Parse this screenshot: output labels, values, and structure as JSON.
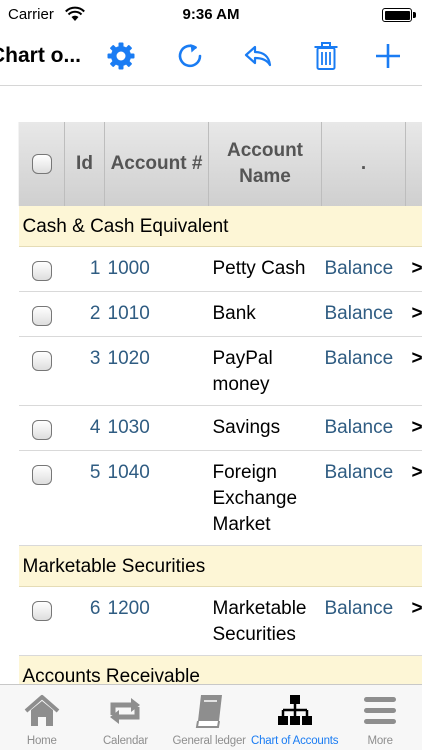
{
  "status_bar": {
    "carrier": "Carrier",
    "time": "9:36 AM"
  },
  "nav": {
    "title": "Chart o...",
    "actions": [
      "gear-icon",
      "refresh-icon",
      "reply-icon",
      "trash-icon",
      "plus-icon"
    ]
  },
  "table": {
    "headers": {
      "id": "Id",
      "account_num": "Account #",
      "account_name": "Account Name",
      "col5": ".",
      "col6": "."
    },
    "groups": [
      {
        "label": "Cash & Cash Equivalent",
        "rows": [
          {
            "id": "1",
            "num": "1000",
            "name": "Petty Cash",
            "action": "Balance",
            "more": ">"
          },
          {
            "id": "2",
            "num": "1010",
            "name": "Bank",
            "action": "Balance",
            "more": ">"
          },
          {
            "id": "3",
            "num": "1020",
            "name": "PayPal money",
            "action": "Balance",
            "more": ">"
          },
          {
            "id": "4",
            "num": "1030",
            "name": "Savings",
            "action": "Balance",
            "more": ">"
          },
          {
            "id": "5",
            "num": "1040",
            "name": "Foreign Exchange Market",
            "action": "Balance",
            "more": ">"
          }
        ]
      },
      {
        "label": "Marketable Securities",
        "rows": [
          {
            "id": "6",
            "num": "1200",
            "name": "Marketable Securities",
            "action": "Balance",
            "more": ">"
          }
        ]
      },
      {
        "label": "Accounts Receivable",
        "rows": []
      }
    ]
  },
  "tabs": [
    {
      "label": "Home",
      "icon": "home-icon"
    },
    {
      "label": "Calendar",
      "icon": "repeat-icon"
    },
    {
      "label": "General ledger",
      "icon": "book-icon"
    },
    {
      "label": "Chart of Accounts",
      "icon": "org-chart-icon",
      "active": true
    },
    {
      "label": "More",
      "icon": "menu-icon"
    }
  ],
  "colors": {
    "accent": "#1a7cf3",
    "link": "#2f5c82",
    "group_bg": "#fdf6d6",
    "inactive_tab": "#8e8e8e"
  }
}
